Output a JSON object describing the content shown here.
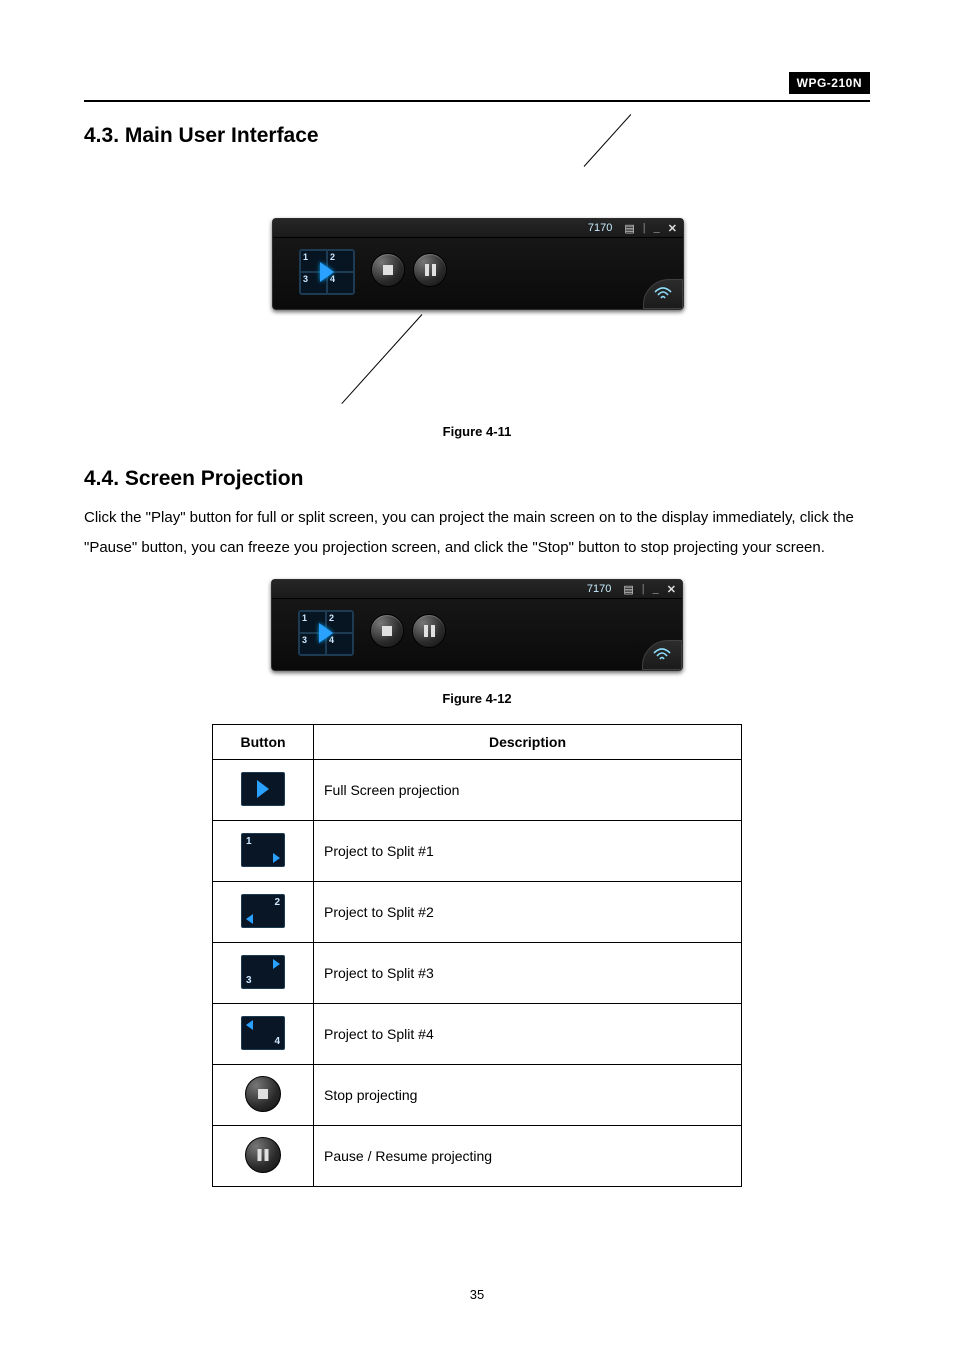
{
  "model_badge": "WPG-210N",
  "section_43_title": "4.3. Main User Interface",
  "figure_11_caption": "Figure 4-11",
  "section_44_title": "4.4. Screen Projection",
  "section_44_body": "Click the \"Play\" button for full or split screen, you can project the main screen on to the display immediately, click the \"Pause\" button, you can freeze you projection screen, and click the \"Stop\" button to stop projecting your screen.",
  "figure_12_caption": "Figure 4-12",
  "control_bar": {
    "code": "7170",
    "quad_labels": {
      "tl": "1",
      "tr": "2",
      "bl": "3",
      "br": "4"
    }
  },
  "table": {
    "header_button": "Button",
    "header_desc": "Description",
    "rows": [
      {
        "key": "full",
        "desc": "Full Screen projection"
      },
      {
        "key": "split1",
        "label": "1",
        "desc": "Project to Split #1"
      },
      {
        "key": "split2",
        "label": "2",
        "desc": "Project to Split #2"
      },
      {
        "key": "split3",
        "label": "3",
        "desc": "Project to Split #3"
      },
      {
        "key": "split4",
        "label": "4",
        "desc": "Project to Split #4"
      },
      {
        "key": "stop",
        "desc": "Stop projecting"
      },
      {
        "key": "pause",
        "desc": "Pause / Resume projecting"
      }
    ]
  },
  "page_number": "35"
}
